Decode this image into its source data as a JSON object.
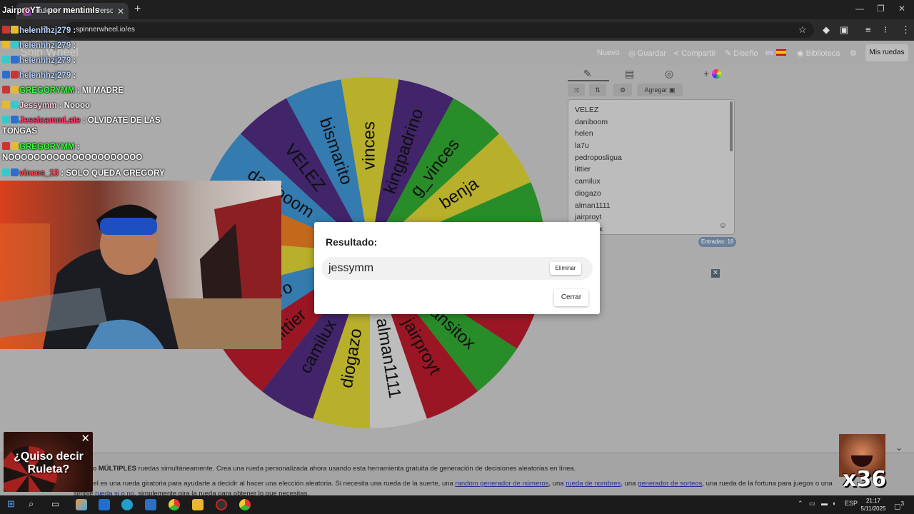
{
  "browser": {
    "tab_title": "Ruleta - Ruleta de Perso",
    "url": "spinnerwheel.io/es",
    "new_tab_glyph": "+",
    "window_controls": [
      "—",
      "❐",
      "✕"
    ]
  },
  "site": {
    "logo": "Spin Wheel",
    "nav": [
      "Nuevo",
      "Guardar",
      "Compartir",
      "Diseño",
      "es",
      "Biblioteca"
    ],
    "my_wheels": "Mis ruedas"
  },
  "panel": {
    "add_button": "Agregar",
    "entries": [
      "VELEZ",
      "daniboom",
      "helen",
      "la7u",
      "pedroposligua",
      "littier",
      "camilux",
      "diogazo",
      "alman1111",
      "jairproyt",
      "dansitox"
    ],
    "entries_count": "Entradas: 18",
    "close_x": "✕"
  },
  "wheel": {
    "slices": [
      {
        "label": "vinces",
        "color": "#d2c832"
      },
      {
        "label": "kingpadrino",
        "color": "#4a2a78"
      },
      {
        "label": "g_vinces",
        "color": "#2ea02e"
      },
      {
        "label": "benja",
        "color": "#d2c832"
      },
      {
        "label": "",
        "color": "#2ea02e"
      },
      {
        "label": "",
        "color": "#d8d8d8"
      },
      {
        "label": "",
        "color": "#b01a2a"
      },
      {
        "label": "dansitox",
        "color": "#2ea02e"
      },
      {
        "label": "jairproyt",
        "color": "#b01a2a"
      },
      {
        "label": "alman1111",
        "color": "#d8d8d8"
      },
      {
        "label": "diogazo",
        "color": "#d2c832"
      },
      {
        "label": "camilux",
        "color": "#4a2a78"
      },
      {
        "label": "littier",
        "color": "#b01a2a"
      },
      {
        "label": "pedro",
        "color": "#3c8cc8"
      },
      {
        "label": "",
        "color": "#d2c832"
      },
      {
        "label": "",
        "color": "#e07820"
      },
      {
        "label": "daniboom",
        "color": "#3c8cc8"
      },
      {
        "label": "VELEZ",
        "color": "#4a2a78"
      },
      {
        "label": "bismarito",
        "color": "#3c8cc8"
      }
    ]
  },
  "dialog": {
    "title": "Resultado:",
    "result": "jessymm",
    "remove": "Eliminar",
    "close": "Cerrar"
  },
  "chat": {
    "lines": [
      {
        "user": "JairproYT",
        "msg": ": por mentimIs",
        "color": "#ffffff"
      },
      {
        "user": "helenhhzj279",
        "msg": ":",
        "color": "#b8d4ff"
      },
      {
        "user": "helenhhzj279",
        "msg": ":",
        "color": "#b8d4ff"
      },
      {
        "user": "helenhhzj279",
        "msg": ":",
        "color": "#b8d4ff"
      },
      {
        "user": "helenhhzj279",
        "msg": ":",
        "color": "#b8d4ff"
      },
      {
        "user": "GREGORYMM",
        "msg": ": MI MADRE",
        "color": "#3cff3c"
      },
      {
        "user": "Jessymm",
        "msg": ": Noooo",
        "color": "#ffd0e0"
      },
      {
        "user": "JessicammLate",
        "msg": ": OLVIDATE DE LAS",
        "color": "#ff3c6a"
      },
      {
        "user": "",
        "msg": "TONGAS",
        "color": "#ffffff"
      },
      {
        "user": "GREGORYMM",
        "msg": ":",
        "color": "#3cff3c"
      },
      {
        "user": "",
        "msg": "NOOOOOOOOOOOOOOOOOOOOO",
        "color": "#ffffff"
      },
      {
        "user": "vinces_13",
        "msg": ": SOLO QUEDA GREGORY",
        "color": "#ff4a4a"
      }
    ]
  },
  "footer": {
    "line1_pre": "rueda o ",
    "line1_bold": "MÚLTIPLES",
    "line1_post": " ruedas simultáneamente. Crea una rueda personalizada ahora usando esta herramienta gratuita de generación de decisiones aleatorias en línea.",
    "line2_pre": "e Wheel es una rueda giratoria para ayudarte a decidir al hacer una elección aleatoria. Si necesita una rueda de la suerte, una ",
    "link1": "random generador de números",
    "line2_mid1": ", una ",
    "link2": "rueda de nombres",
    "line2_mid2": ", una ",
    "link3": "generador de sorteos",
    "line2_post": ", una rueda de la fortuna para juegos o una",
    "line3_pre": "simple ",
    "link4": "rueda si o no",
    "line3_post": ", simplemente gira la rueda para obtener lo que necesitas."
  },
  "ad": {
    "text": "¿Quiso decir Ruleta?",
    "close": "✕"
  },
  "overlay": {
    "multiplier": "x36"
  },
  "taskbar": {
    "lang": "ESP",
    "time": "21:17",
    "date": "5/11/2025",
    "notifications": "3"
  },
  "colors": {
    "accent_green": "#3cff3c",
    "dialog_bg": "#ffffff",
    "page_dim": "#ababab"
  }
}
